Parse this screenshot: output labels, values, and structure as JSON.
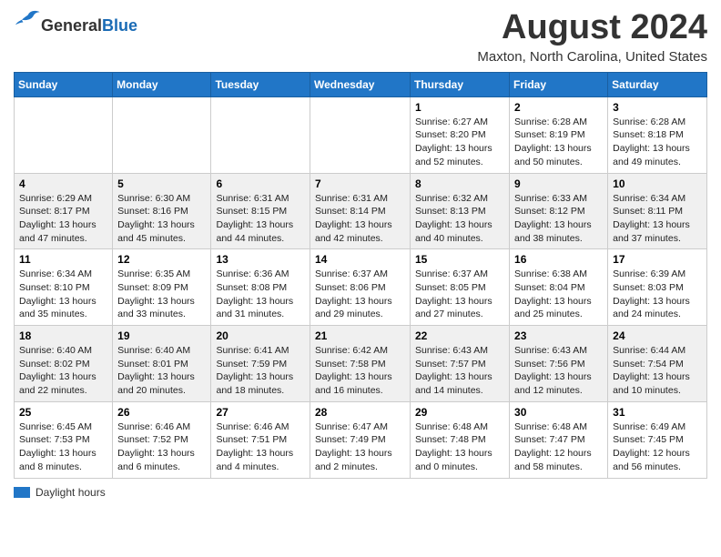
{
  "header": {
    "logo_general": "General",
    "logo_blue": "Blue",
    "month_title": "August 2024",
    "location": "Maxton, North Carolina, United States"
  },
  "days_of_week": [
    "Sunday",
    "Monday",
    "Tuesday",
    "Wednesday",
    "Thursday",
    "Friday",
    "Saturday"
  ],
  "legend_label": "Daylight hours",
  "weeks": [
    [
      {
        "day": "",
        "info": ""
      },
      {
        "day": "",
        "info": ""
      },
      {
        "day": "",
        "info": ""
      },
      {
        "day": "",
        "info": ""
      },
      {
        "day": "1",
        "info": "Sunrise: 6:27 AM\nSunset: 8:20 PM\nDaylight: 13 hours\nand 52 minutes."
      },
      {
        "day": "2",
        "info": "Sunrise: 6:28 AM\nSunset: 8:19 PM\nDaylight: 13 hours\nand 50 minutes."
      },
      {
        "day": "3",
        "info": "Sunrise: 6:28 AM\nSunset: 8:18 PM\nDaylight: 13 hours\nand 49 minutes."
      }
    ],
    [
      {
        "day": "4",
        "info": "Sunrise: 6:29 AM\nSunset: 8:17 PM\nDaylight: 13 hours\nand 47 minutes."
      },
      {
        "day": "5",
        "info": "Sunrise: 6:30 AM\nSunset: 8:16 PM\nDaylight: 13 hours\nand 45 minutes."
      },
      {
        "day": "6",
        "info": "Sunrise: 6:31 AM\nSunset: 8:15 PM\nDaylight: 13 hours\nand 44 minutes."
      },
      {
        "day": "7",
        "info": "Sunrise: 6:31 AM\nSunset: 8:14 PM\nDaylight: 13 hours\nand 42 minutes."
      },
      {
        "day": "8",
        "info": "Sunrise: 6:32 AM\nSunset: 8:13 PM\nDaylight: 13 hours\nand 40 minutes."
      },
      {
        "day": "9",
        "info": "Sunrise: 6:33 AM\nSunset: 8:12 PM\nDaylight: 13 hours\nand 38 minutes."
      },
      {
        "day": "10",
        "info": "Sunrise: 6:34 AM\nSunset: 8:11 PM\nDaylight: 13 hours\nand 37 minutes."
      }
    ],
    [
      {
        "day": "11",
        "info": "Sunrise: 6:34 AM\nSunset: 8:10 PM\nDaylight: 13 hours\nand 35 minutes."
      },
      {
        "day": "12",
        "info": "Sunrise: 6:35 AM\nSunset: 8:09 PM\nDaylight: 13 hours\nand 33 minutes."
      },
      {
        "day": "13",
        "info": "Sunrise: 6:36 AM\nSunset: 8:08 PM\nDaylight: 13 hours\nand 31 minutes."
      },
      {
        "day": "14",
        "info": "Sunrise: 6:37 AM\nSunset: 8:06 PM\nDaylight: 13 hours\nand 29 minutes."
      },
      {
        "day": "15",
        "info": "Sunrise: 6:37 AM\nSunset: 8:05 PM\nDaylight: 13 hours\nand 27 minutes."
      },
      {
        "day": "16",
        "info": "Sunrise: 6:38 AM\nSunset: 8:04 PM\nDaylight: 13 hours\nand 25 minutes."
      },
      {
        "day": "17",
        "info": "Sunrise: 6:39 AM\nSunset: 8:03 PM\nDaylight: 13 hours\nand 24 minutes."
      }
    ],
    [
      {
        "day": "18",
        "info": "Sunrise: 6:40 AM\nSunset: 8:02 PM\nDaylight: 13 hours\nand 22 minutes."
      },
      {
        "day": "19",
        "info": "Sunrise: 6:40 AM\nSunset: 8:01 PM\nDaylight: 13 hours\nand 20 minutes."
      },
      {
        "day": "20",
        "info": "Sunrise: 6:41 AM\nSunset: 7:59 PM\nDaylight: 13 hours\nand 18 minutes."
      },
      {
        "day": "21",
        "info": "Sunrise: 6:42 AM\nSunset: 7:58 PM\nDaylight: 13 hours\nand 16 minutes."
      },
      {
        "day": "22",
        "info": "Sunrise: 6:43 AM\nSunset: 7:57 PM\nDaylight: 13 hours\nand 14 minutes."
      },
      {
        "day": "23",
        "info": "Sunrise: 6:43 AM\nSunset: 7:56 PM\nDaylight: 13 hours\nand 12 minutes."
      },
      {
        "day": "24",
        "info": "Sunrise: 6:44 AM\nSunset: 7:54 PM\nDaylight: 13 hours\nand 10 minutes."
      }
    ],
    [
      {
        "day": "25",
        "info": "Sunrise: 6:45 AM\nSunset: 7:53 PM\nDaylight: 13 hours\nand 8 minutes."
      },
      {
        "day": "26",
        "info": "Sunrise: 6:46 AM\nSunset: 7:52 PM\nDaylight: 13 hours\nand 6 minutes."
      },
      {
        "day": "27",
        "info": "Sunrise: 6:46 AM\nSunset: 7:51 PM\nDaylight: 13 hours\nand 4 minutes."
      },
      {
        "day": "28",
        "info": "Sunrise: 6:47 AM\nSunset: 7:49 PM\nDaylight: 13 hours\nand 2 minutes."
      },
      {
        "day": "29",
        "info": "Sunrise: 6:48 AM\nSunset: 7:48 PM\nDaylight: 13 hours\nand 0 minutes."
      },
      {
        "day": "30",
        "info": "Sunrise: 6:48 AM\nSunset: 7:47 PM\nDaylight: 12 hours\nand 58 minutes."
      },
      {
        "day": "31",
        "info": "Sunrise: 6:49 AM\nSunset: 7:45 PM\nDaylight: 12 hours\nand 56 minutes."
      }
    ]
  ]
}
